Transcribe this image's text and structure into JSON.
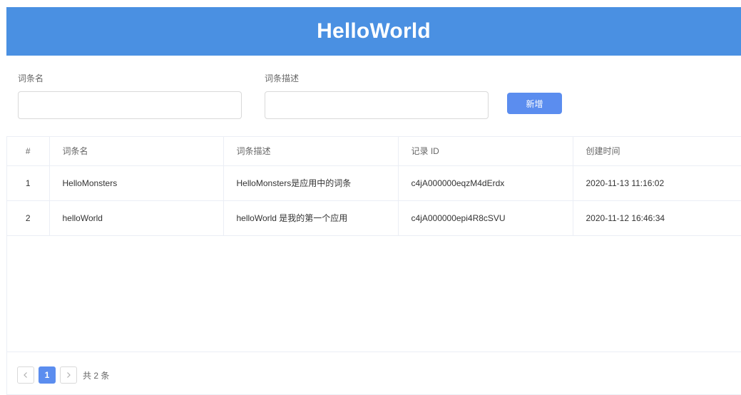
{
  "header": {
    "title": "HelloWorld"
  },
  "form": {
    "name_label": "词条名",
    "name_value": "",
    "desc_label": "词条描述",
    "desc_value": "",
    "add_label": "新增"
  },
  "table": {
    "columns": [
      "#",
      "词条名",
      "词条描述",
      "记录 ID",
      "创建时间"
    ],
    "rows": [
      {
        "index": "1",
        "name": "HelloMonsters",
        "desc": "HelloMonsters是应用中的词条",
        "id": "c4jA000000eqzM4dErdx",
        "created": "2020-11-13 11:16:02"
      },
      {
        "index": "2",
        "name": "helloWorld",
        "desc": "helloWorld 是我的第一个应用",
        "id": "c4jA000000epi4R8cSVU",
        "created": "2020-11-12 16:46:34"
      }
    ]
  },
  "pagination": {
    "prev_icon": "chevron-left-icon",
    "next_icon": "chevron-right-icon",
    "current_page": "1",
    "total_text": "共 2 条"
  },
  "colors": {
    "header_bg": "#4a90e2",
    "accent": "#5b8def"
  }
}
